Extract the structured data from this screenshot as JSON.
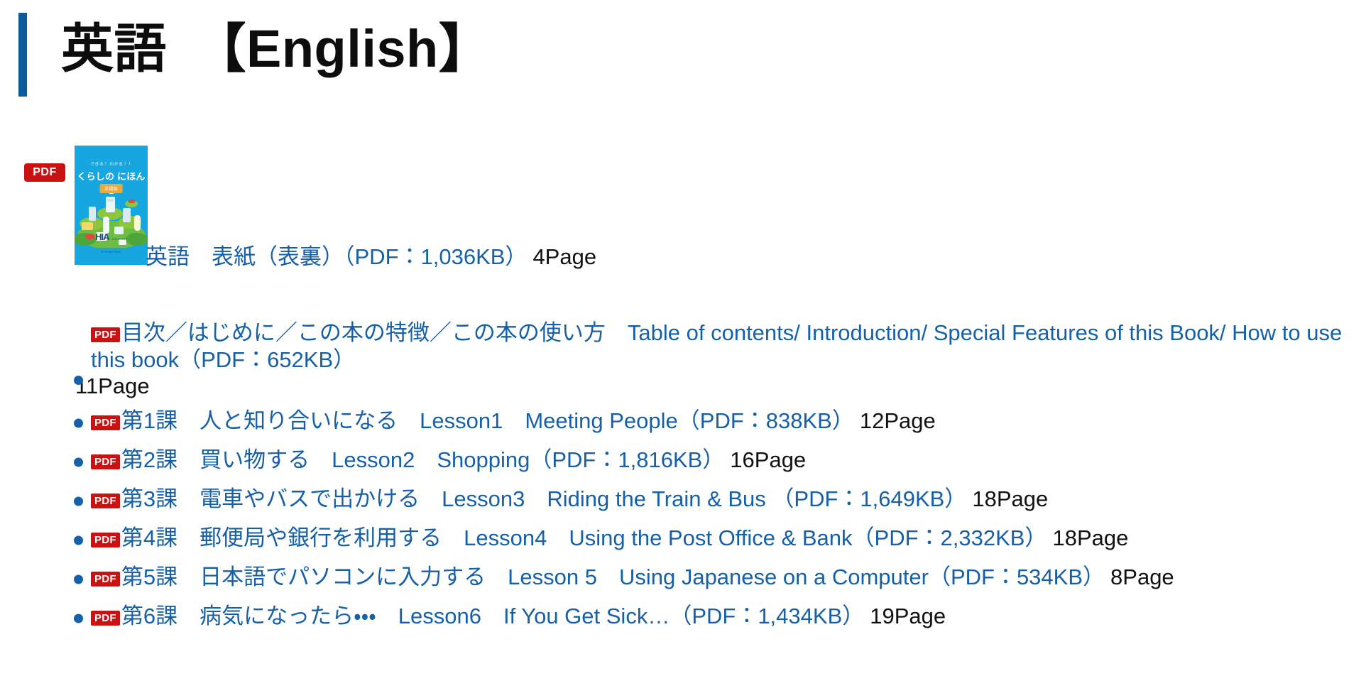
{
  "header": {
    "title": "英語　【English】",
    "accent_color": "#0b5b9b"
  },
  "cover": {
    "badge": "PDF",
    "thumb_alt": "くらしの にほんご 表紙",
    "thumb_sub_title": "できる！ わかる！！",
    "thumb_title": "くらしの にほんご",
    "thumb_chip": "英語版",
    "thumb_footer": "公益財団法人 広島県国際交流協会",
    "thumb_logo": "HIA",
    "thumb_logo_sub": "HIROSHIMA INTERNATIONAL",
    "background_color": "#17a7e0"
  },
  "cover_caption": {
    "link_text": "英語　表紙（表裏）（PDF：1,036KB）",
    "pages": "4Page"
  },
  "colors": {
    "link": "#1560a8",
    "pdf_badge": "#cc1111",
    "text": "#111111"
  },
  "list": [
    {
      "badge": "PDF",
      "link_text": "目次／はじめに／この本の特徴／この本の使い方　Table of contents/ Introduction/ Special Features of this Book/ How to use this book（PDF：652KB）",
      "pages": "11Page",
      "multiline": true
    },
    {
      "badge": "PDF",
      "link_text": "第1課　人と知り合いになる　Lesson1　Meeting People（PDF：838KB）",
      "pages": "12Page",
      "multiline": false
    },
    {
      "badge": "PDF",
      "link_text": "第2課　買い物する　Lesson2　Shopping（PDF：1,816KB）",
      "pages": "16Page",
      "multiline": false
    },
    {
      "badge": "PDF",
      "link_text": "第3課　電車やバスで出かける　Lesson3　Riding the Train & Bus （PDF：1,649KB）",
      "pages": "18Page",
      "multiline": false
    },
    {
      "badge": "PDF",
      "link_text": "第4課　郵便局や銀行を利用する　Lesson4　Using the Post Office & Bank（PDF：2,332KB）",
      "pages": "18Page",
      "multiline": false
    },
    {
      "badge": "PDF",
      "link_text": "第5課　日本語でパソコンに入力する　Lesson 5　Using Japanese on a Computer（PDF：534KB）",
      "pages": "8Page",
      "multiline": false
    },
    {
      "badge": "PDF",
      "link_text": "第6課　病気になったら・・・　Lesson6　If You Get Sick…（PDF：1,434KB）",
      "pages": "19Page",
      "multiline": false
    }
  ]
}
